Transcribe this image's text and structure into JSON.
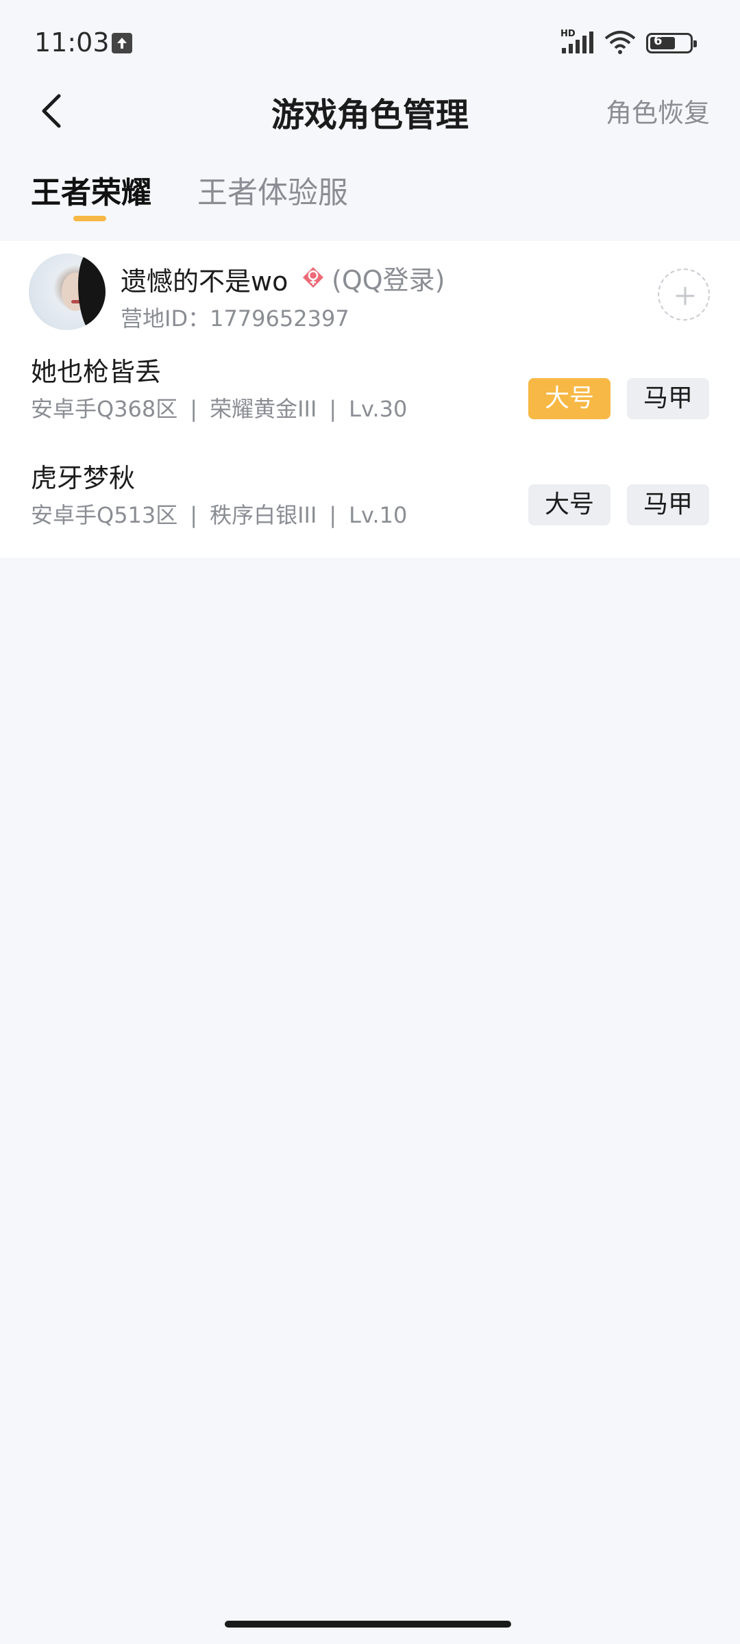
{
  "status_bar": {
    "time": "11:03",
    "network_label": "HD",
    "battery_level": "6"
  },
  "header": {
    "title": "游戏角色管理",
    "restore_label": "角色恢复"
  },
  "tabs": [
    {
      "label": "王者荣耀",
      "active": true
    },
    {
      "label": "王者体验服",
      "active": false
    }
  ],
  "account": {
    "name": "遗憾的不是wo",
    "login_type": "(QQ登录)",
    "camp_id": "营地ID：1779652397"
  },
  "roles": [
    {
      "name": "她也枪皆丢",
      "server": "安卓手Q368区",
      "rank": "荣耀黄金III",
      "level": "Lv.30",
      "main_label": "大号",
      "alt_label": "马甲",
      "selected": "main"
    },
    {
      "name": "虎牙梦秋",
      "server": "安卓手Q513区",
      "rank": "秩序白银III",
      "level": "Lv.10",
      "main_label": "大号",
      "alt_label": "马甲",
      "selected": "none"
    }
  ],
  "colors": {
    "accent": "#f7b845",
    "background": "#f6f7fb",
    "muted_text": "#8a8d93"
  }
}
